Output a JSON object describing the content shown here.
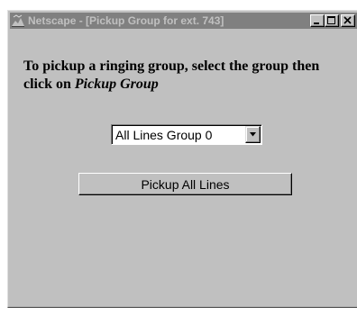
{
  "window": {
    "title": "Netscape - [Pickup Group for ext. 743]",
    "controls": {
      "minimize_icon": "minimize-icon",
      "maximize_icon": "maximize-icon",
      "close_icon": "close-icon"
    }
  },
  "content": {
    "instruction_text": "To pickup a ringing group, select the group then click on ",
    "instruction_emphasis": "Pickup Group",
    "group_select": {
      "selected": "All Lines Group 0"
    },
    "pickup_button_label": "Pickup All Lines"
  },
  "colors": {
    "window_bg": "#c0c0c0",
    "titlebar_inactive": "#808080"
  }
}
